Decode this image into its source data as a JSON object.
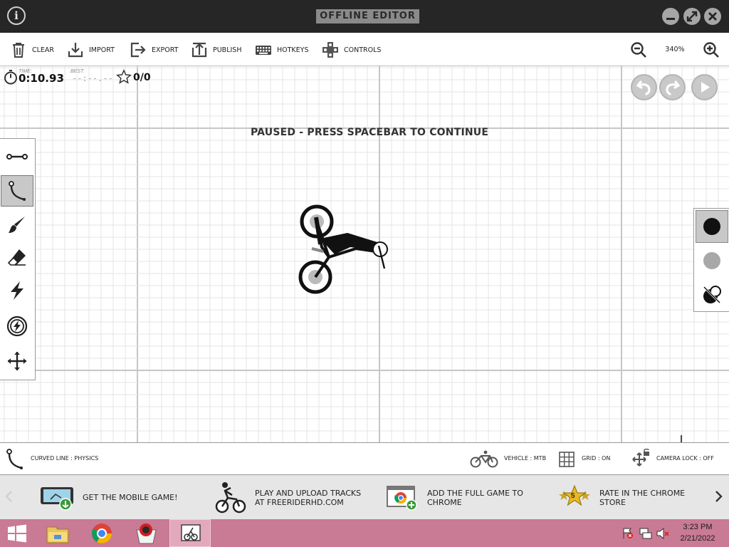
{
  "window": {
    "title": "OFFLINE EDITOR",
    "info_label": "i"
  },
  "toolbar": {
    "items": [
      {
        "label": "CLEAR",
        "icon": "trash-icon"
      },
      {
        "label": "IMPORT",
        "icon": "import-icon"
      },
      {
        "label": "EXPORT",
        "icon": "export-icon"
      },
      {
        "label": "PUBLISH",
        "icon": "publish-icon"
      },
      {
        "label": "HOTKEYS",
        "icon": "keyboard-icon"
      },
      {
        "label": "CONTROLS",
        "icon": "gamepad-icon"
      }
    ],
    "zoom_level": "340%"
  },
  "hud": {
    "time_caption": "TIME:",
    "time": "0:10.93",
    "best_caption": "BEST:",
    "best": "--:--.--",
    "targets": "0/0",
    "paused_message": "PAUSED - PRESS SPACEBAR TO CONTINUE"
  },
  "tools": [
    {
      "name": "straight-line",
      "icon": "straight-line-icon",
      "active": false
    },
    {
      "name": "curved-line",
      "icon": "curve-icon",
      "active": true
    },
    {
      "name": "brush",
      "icon": "brush-icon",
      "active": false
    },
    {
      "name": "eraser",
      "icon": "eraser-icon",
      "active": false
    },
    {
      "name": "powerups",
      "icon": "lightning-icon",
      "active": false
    },
    {
      "name": "vehicle-powerups",
      "icon": "circle-lightning-icon",
      "active": false
    },
    {
      "name": "camera",
      "icon": "move-icon",
      "active": false
    }
  ],
  "colors": [
    {
      "name": "physics",
      "color": "#111111",
      "active": true
    },
    {
      "name": "scenery",
      "color": "#a8a8a8",
      "active": false
    },
    {
      "name": "no-color",
      "icon": "no-color-icon",
      "active": false
    }
  ],
  "status": {
    "tool": "CURVED LINE : PHYSICS",
    "vehicle": "VEHICLE : MTB",
    "grid": "GRID : ON",
    "camera_lock": "CAMERA LOCK : OFF"
  },
  "promo": {
    "items": [
      {
        "line1": "GET THE MOBILE GAME!",
        "line2": ""
      },
      {
        "line1": "PLAY AND UPLOAD TRACKS",
        "line2": "AT FREERIDERHD.COM"
      },
      {
        "line1": "ADD THE FULL GAME TO",
        "line2": "CHROME"
      },
      {
        "line1": "RATE IN THE CHROME",
        "line2": "STORE"
      }
    ],
    "star_badge": "5"
  },
  "taskbar": {
    "time": "3:23 PM",
    "date": "2/21/2022"
  },
  "theme": {
    "titlebar_bg": "#262626",
    "taskbar_bg": "#c97a95",
    "grid_minor": "#e4e4e4",
    "grid_major": "#c6c6c6"
  }
}
